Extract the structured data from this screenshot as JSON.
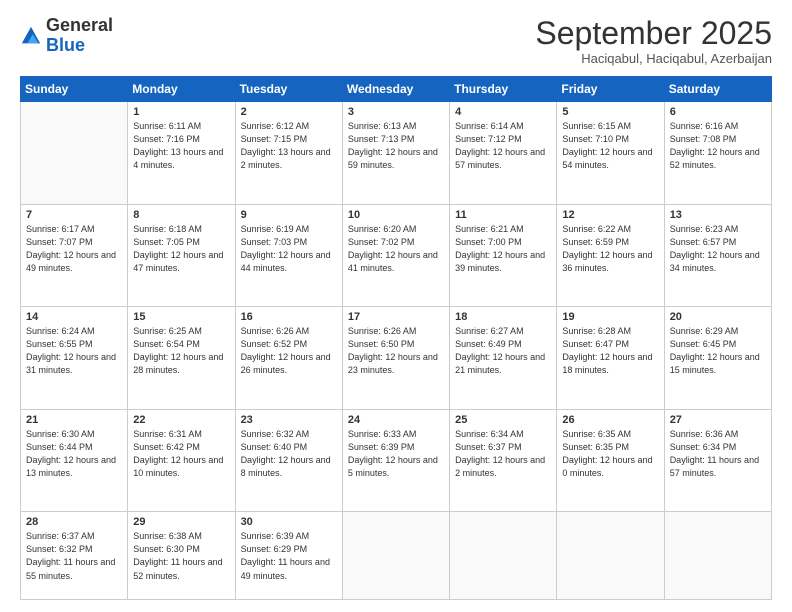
{
  "logo": {
    "general": "General",
    "blue": "Blue"
  },
  "title": "September 2025",
  "location": "Haciqabul, Haciqabul, Azerbaijan",
  "weekdays": [
    "Sunday",
    "Monday",
    "Tuesday",
    "Wednesday",
    "Thursday",
    "Friday",
    "Saturday"
  ],
  "weeks": [
    [
      null,
      {
        "day": "1",
        "sunrise": "6:11 AM",
        "sunset": "7:16 PM",
        "daylight": "13 hours and 4 minutes."
      },
      {
        "day": "2",
        "sunrise": "6:12 AM",
        "sunset": "7:15 PM",
        "daylight": "13 hours and 2 minutes."
      },
      {
        "day": "3",
        "sunrise": "6:13 AM",
        "sunset": "7:13 PM",
        "daylight": "12 hours and 59 minutes."
      },
      {
        "day": "4",
        "sunrise": "6:14 AM",
        "sunset": "7:12 PM",
        "daylight": "12 hours and 57 minutes."
      },
      {
        "day": "5",
        "sunrise": "6:15 AM",
        "sunset": "7:10 PM",
        "daylight": "12 hours and 54 minutes."
      },
      {
        "day": "6",
        "sunrise": "6:16 AM",
        "sunset": "7:08 PM",
        "daylight": "12 hours and 52 minutes."
      }
    ],
    [
      {
        "day": "7",
        "sunrise": "6:17 AM",
        "sunset": "7:07 PM",
        "daylight": "12 hours and 49 minutes."
      },
      {
        "day": "8",
        "sunrise": "6:18 AM",
        "sunset": "7:05 PM",
        "daylight": "12 hours and 47 minutes."
      },
      {
        "day": "9",
        "sunrise": "6:19 AM",
        "sunset": "7:03 PM",
        "daylight": "12 hours and 44 minutes."
      },
      {
        "day": "10",
        "sunrise": "6:20 AM",
        "sunset": "7:02 PM",
        "daylight": "12 hours and 41 minutes."
      },
      {
        "day": "11",
        "sunrise": "6:21 AM",
        "sunset": "7:00 PM",
        "daylight": "12 hours and 39 minutes."
      },
      {
        "day": "12",
        "sunrise": "6:22 AM",
        "sunset": "6:59 PM",
        "daylight": "12 hours and 36 minutes."
      },
      {
        "day": "13",
        "sunrise": "6:23 AM",
        "sunset": "6:57 PM",
        "daylight": "12 hours and 34 minutes."
      }
    ],
    [
      {
        "day": "14",
        "sunrise": "6:24 AM",
        "sunset": "6:55 PM",
        "daylight": "12 hours and 31 minutes."
      },
      {
        "day": "15",
        "sunrise": "6:25 AM",
        "sunset": "6:54 PM",
        "daylight": "12 hours and 28 minutes."
      },
      {
        "day": "16",
        "sunrise": "6:26 AM",
        "sunset": "6:52 PM",
        "daylight": "12 hours and 26 minutes."
      },
      {
        "day": "17",
        "sunrise": "6:26 AM",
        "sunset": "6:50 PM",
        "daylight": "12 hours and 23 minutes."
      },
      {
        "day": "18",
        "sunrise": "6:27 AM",
        "sunset": "6:49 PM",
        "daylight": "12 hours and 21 minutes."
      },
      {
        "day": "19",
        "sunrise": "6:28 AM",
        "sunset": "6:47 PM",
        "daylight": "12 hours and 18 minutes."
      },
      {
        "day": "20",
        "sunrise": "6:29 AM",
        "sunset": "6:45 PM",
        "daylight": "12 hours and 15 minutes."
      }
    ],
    [
      {
        "day": "21",
        "sunrise": "6:30 AM",
        "sunset": "6:44 PM",
        "daylight": "12 hours and 13 minutes."
      },
      {
        "day": "22",
        "sunrise": "6:31 AM",
        "sunset": "6:42 PM",
        "daylight": "12 hours and 10 minutes."
      },
      {
        "day": "23",
        "sunrise": "6:32 AM",
        "sunset": "6:40 PM",
        "daylight": "12 hours and 8 minutes."
      },
      {
        "day": "24",
        "sunrise": "6:33 AM",
        "sunset": "6:39 PM",
        "daylight": "12 hours and 5 minutes."
      },
      {
        "day": "25",
        "sunrise": "6:34 AM",
        "sunset": "6:37 PM",
        "daylight": "12 hours and 2 minutes."
      },
      {
        "day": "26",
        "sunrise": "6:35 AM",
        "sunset": "6:35 PM",
        "daylight": "12 hours and 0 minutes."
      },
      {
        "day": "27",
        "sunrise": "6:36 AM",
        "sunset": "6:34 PM",
        "daylight": "11 hours and 57 minutes."
      }
    ],
    [
      {
        "day": "28",
        "sunrise": "6:37 AM",
        "sunset": "6:32 PM",
        "daylight": "11 hours and 55 minutes."
      },
      {
        "day": "29",
        "sunrise": "6:38 AM",
        "sunset": "6:30 PM",
        "daylight": "11 hours and 52 minutes."
      },
      {
        "day": "30",
        "sunrise": "6:39 AM",
        "sunset": "6:29 PM",
        "daylight": "11 hours and 49 minutes."
      },
      null,
      null,
      null,
      null
    ]
  ]
}
